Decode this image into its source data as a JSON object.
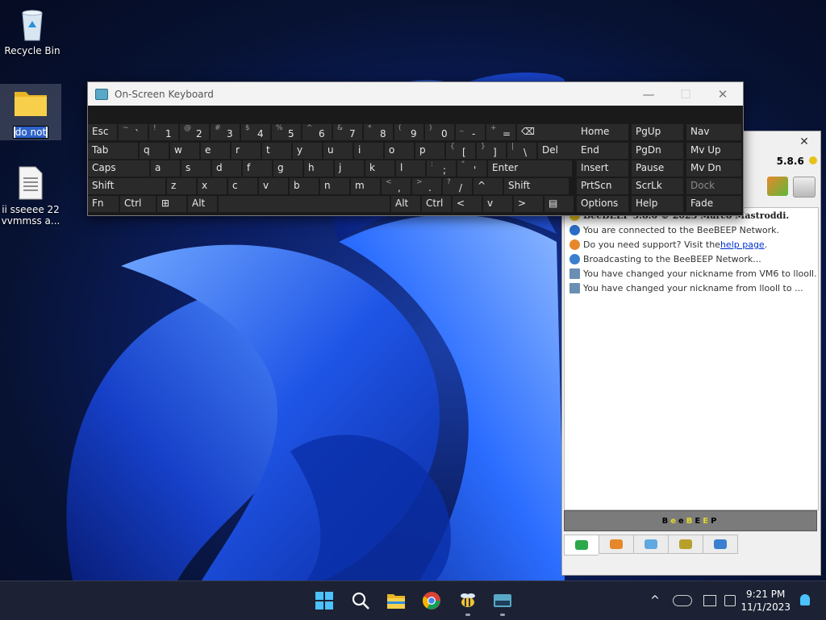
{
  "desktop": {
    "icons": [
      {
        "label": "Recycle Bin"
      },
      {
        "label": "do not",
        "renaming": true
      },
      {
        "label": "ii  sseeee  22 vvmmss  a..."
      }
    ]
  },
  "osk": {
    "title": "On-Screen Keyboard",
    "controls": {
      "minimize": "—",
      "maximize": "☐",
      "close": "✕"
    },
    "rows": [
      [
        {
          "m": "Esc"
        },
        {
          "s": "~",
          "m": "`"
        },
        {
          "s": "!",
          "m": "1"
        },
        {
          "s": "@",
          "m": "2"
        },
        {
          "s": "#",
          "m": "3"
        },
        {
          "s": "$",
          "m": "4"
        },
        {
          "s": "%",
          "m": "5"
        },
        {
          "s": "^",
          "m": "6"
        },
        {
          "s": "&",
          "m": "7"
        },
        {
          "s": "*",
          "m": "8"
        },
        {
          "s": "(",
          "m": "9"
        },
        {
          "s": ")",
          "m": "0"
        },
        {
          "s": "_",
          "m": "-"
        },
        {
          "s": "+",
          "m": "="
        },
        {
          "m": "⌫"
        }
      ],
      [
        {
          "m": "Tab"
        },
        {
          "m": "q"
        },
        {
          "m": "w"
        },
        {
          "m": "e"
        },
        {
          "m": "r"
        },
        {
          "m": "t"
        },
        {
          "m": "y"
        },
        {
          "m": "u"
        },
        {
          "m": "i"
        },
        {
          "m": "o"
        },
        {
          "m": "p"
        },
        {
          "s": "{",
          "m": "["
        },
        {
          "s": "}",
          "m": "]"
        },
        {
          "s": "|",
          "m": "\\"
        },
        {
          "m": "Del"
        }
      ],
      [
        {
          "m": "Caps"
        },
        {
          "m": "a"
        },
        {
          "m": "s"
        },
        {
          "m": "d"
        },
        {
          "m": "f"
        },
        {
          "m": "g"
        },
        {
          "m": "h"
        },
        {
          "m": "j"
        },
        {
          "m": "k"
        },
        {
          "m": "l"
        },
        {
          "s": ":",
          "m": ";"
        },
        {
          "s": "\"",
          "m": "'"
        },
        {
          "m": "Enter"
        }
      ],
      [
        {
          "m": "Shift"
        },
        {
          "m": "z"
        },
        {
          "m": "x"
        },
        {
          "m": "c"
        },
        {
          "m": "v"
        },
        {
          "m": "b"
        },
        {
          "m": "n"
        },
        {
          "m": "m"
        },
        {
          "s": "<",
          "m": ","
        },
        {
          "s": ">",
          "m": "."
        },
        {
          "s": "?",
          "m": "/"
        },
        {
          "m": "^"
        },
        {
          "m": "Shift"
        }
      ],
      [
        {
          "m": "Fn"
        },
        {
          "m": "Ctrl"
        },
        {
          "m": "⊞"
        },
        {
          "m": "Alt"
        },
        {
          "m": ""
        },
        {
          "m": "Alt"
        },
        {
          "m": "Ctrl"
        },
        {
          "m": "<"
        },
        {
          "m": "v"
        },
        {
          "m": ">"
        },
        {
          "m": "▤"
        }
      ]
    ],
    "nav": [
      [
        "Home",
        "PgUp",
        "Nav"
      ],
      [
        "End",
        "PgDn",
        "Mv Up"
      ],
      [
        "Insert",
        "Pause",
        "Mv Dn"
      ],
      [
        "PrtScn",
        "ScrLk",
        "Dock"
      ],
      [
        "Options",
        "Help",
        "Fade"
      ]
    ]
  },
  "beebeep": {
    "close": "✕",
    "version": "5.8.6",
    "log": [
      {
        "text": "BeeBEEP 5.8.6 © 2023 Marco Mastroddi.",
        "color": "#e6c21a",
        "bold": true
      },
      {
        "text": "You are connected to the BeeBEEP Network.",
        "color": "#2a6fc9"
      },
      {
        "text": "Do you need support? Visit the ",
        "link": "help page",
        "after": ".",
        "color": "#e6882a"
      },
      {
        "text": "Broadcasting to the BeeBEEP Network...",
        "color": "#3a7fd0"
      },
      {
        "text": "You have changed your nickname from VM6 to llooll.",
        "color": "#6a8fb3"
      },
      {
        "text": "You have changed your nickname from llooll to ...",
        "color": "#6a8fb3"
      }
    ],
    "banner": {
      "a": "B",
      "b": "e",
      "c": "e",
      "d": "B",
      "e": "E",
      "f": "E",
      "g": "P"
    }
  },
  "taskbar": {
    "clock_time": "9:21 PM",
    "clock_date": "11/1/2023",
    "chevron": "^"
  },
  "colors": {
    "accent": "#2f63c9",
    "taskbar": "#1c2233"
  }
}
